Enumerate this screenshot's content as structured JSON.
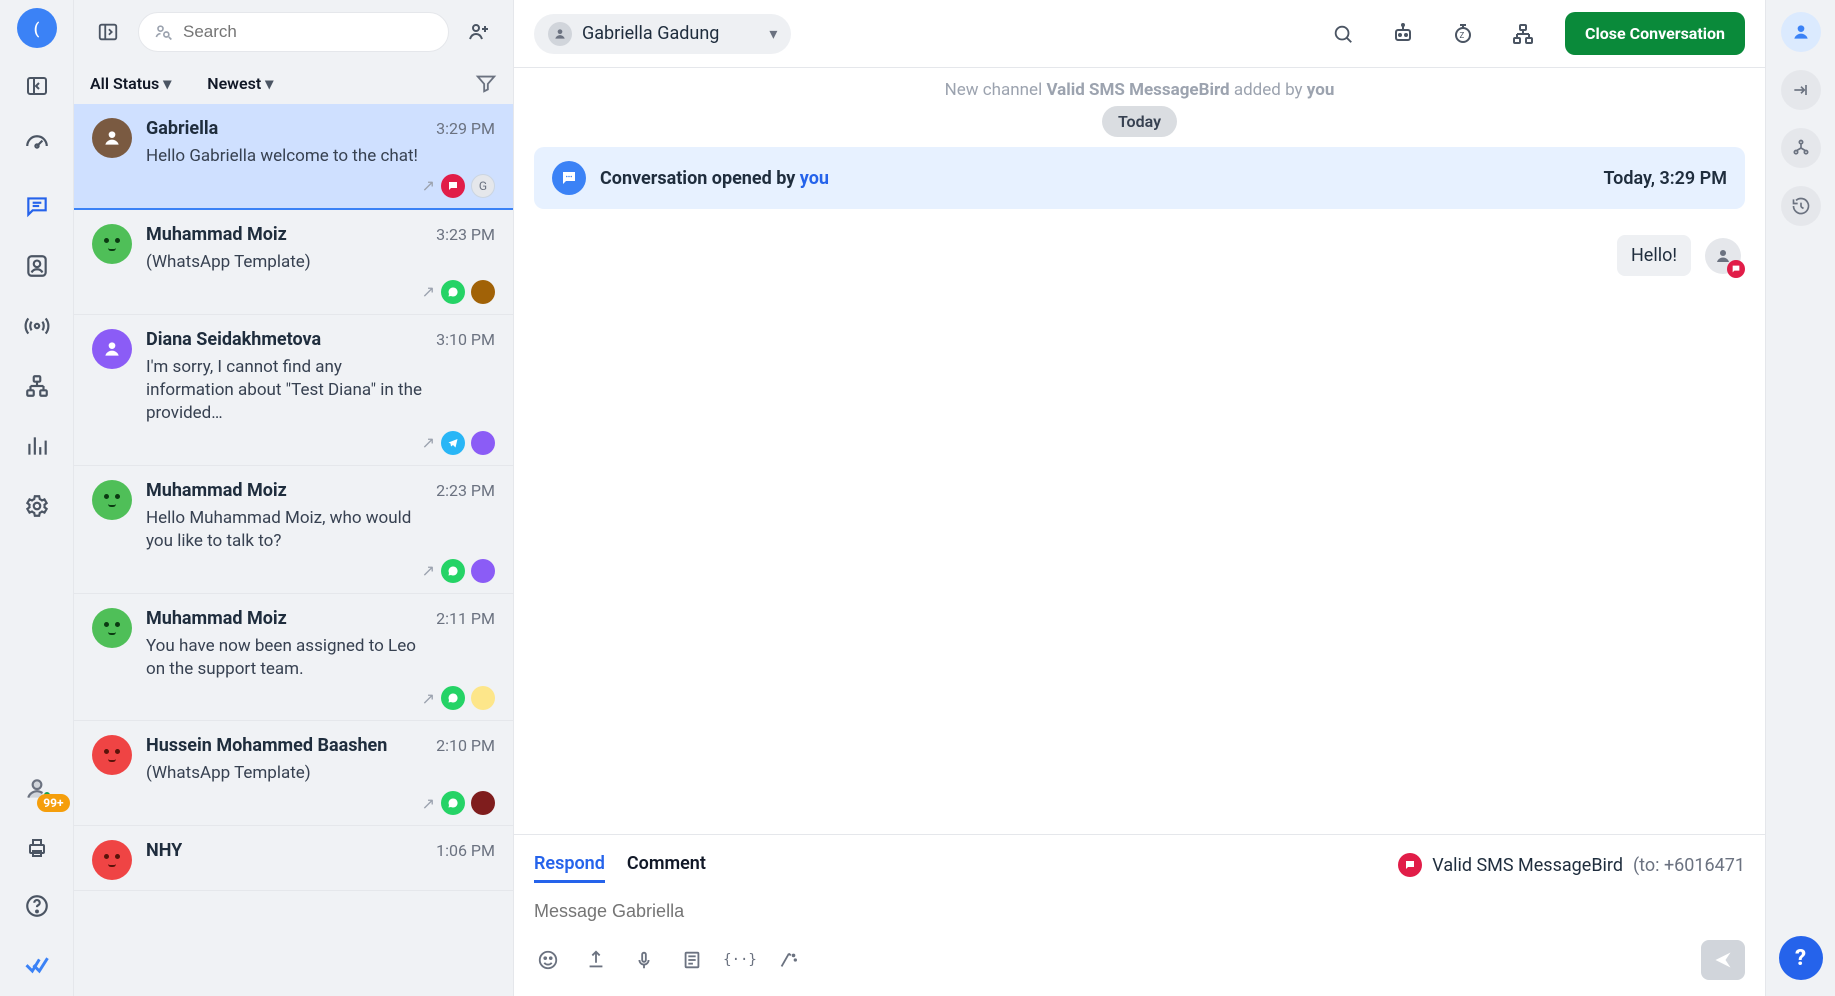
{
  "rail": {
    "badge": "99+"
  },
  "list": {
    "search_placeholder": "Search",
    "filter_status": "All Status",
    "filter_sort": "Newest",
    "items": [
      {
        "name": "Gabriella",
        "time": "3:29 PM",
        "message": "Hello Gabriella welcome to the chat!",
        "avatarColor": "brown",
        "channel": "sms",
        "agentInitial": "G",
        "selected": true
      },
      {
        "name": "Muhammad Moiz",
        "time": "3:23 PM",
        "message": "(WhatsApp Template)",
        "avatarColor": "green",
        "channel": "wa"
      },
      {
        "name": "Diana Seidakhmetova",
        "time": "3:10 PM",
        "message": "I'm sorry, I cannot find any information about \"Test Diana\" in the provided…",
        "avatarColor": "img",
        "channel": "tg"
      },
      {
        "name": "Muhammad Moiz",
        "time": "2:23 PM",
        "message": "Hello Muhammad Moiz, who would you like to talk to?",
        "avatarColor": "green",
        "channel": "wa"
      },
      {
        "name": "Muhammad Moiz",
        "time": "2:11 PM",
        "message": "You have now been assigned to Leo on the support team.",
        "avatarColor": "green",
        "channel": "wa"
      },
      {
        "name": "Hussein Mohammed Baashen",
        "time": "2:10 PM",
        "message": "(WhatsApp Template)",
        "avatarColor": "orange",
        "channel": "wa"
      },
      {
        "name": "NHY",
        "time": "1:06 PM",
        "message": "",
        "avatarColor": "orange",
        "channel": "wa"
      }
    ]
  },
  "chat": {
    "contact_name": "Gabriella Gadung",
    "close_label": "Close Conversation",
    "sys_prefix": "New channel ",
    "sys_strong": "Valid SMS MessageBird",
    "sys_middle": " added by ",
    "sys_you": "you",
    "day_label": "Today",
    "banner_text": "Conversation opened by ",
    "banner_you": "you",
    "banner_time": "Today, 3:29 PM",
    "msg1_text": "Hello!"
  },
  "composer": {
    "tab_respond": "Respond",
    "tab_comment": "Comment",
    "channel_label": "Valid SMS MessageBird",
    "channel_to": "(to: +6016471",
    "placeholder": "Message Gabriella"
  }
}
